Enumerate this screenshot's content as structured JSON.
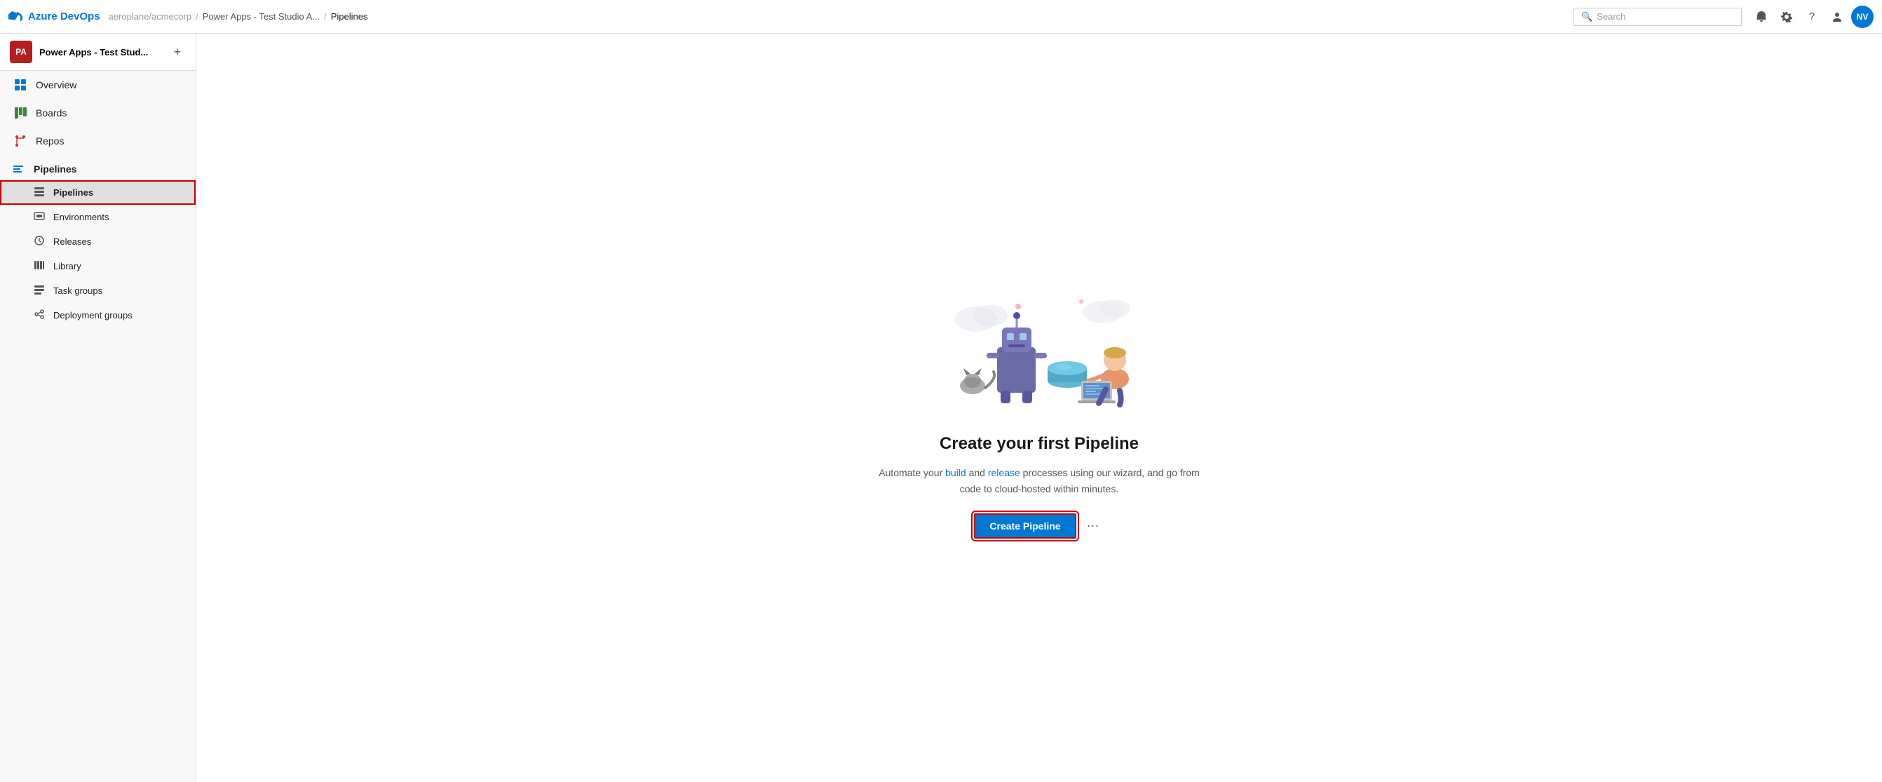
{
  "topNav": {
    "logoText": "Azure DevOps",
    "breadcrumb": {
      "org": "aeroplane/acmecorp",
      "sep1": "/",
      "project": "Power Apps - Test Studio A...",
      "sep2": "/",
      "current": "Pipelines"
    },
    "search": {
      "placeholder": "Search"
    },
    "avatarText": "NV"
  },
  "sidebar": {
    "projectAvatarText": "PA",
    "projectName": "Power Apps - Test Stud...",
    "addButtonLabel": "+",
    "navItems": [
      {
        "id": "overview",
        "label": "Overview",
        "icon": "overview"
      },
      {
        "id": "boards",
        "label": "Boards",
        "icon": "boards"
      },
      {
        "id": "repos",
        "label": "Repos",
        "icon": "repos"
      },
      {
        "id": "pipelines-section",
        "label": "Pipelines",
        "icon": "pipelines"
      }
    ],
    "subItems": [
      {
        "id": "pipelines",
        "label": "Pipelines",
        "icon": "pipelines-sub",
        "active": true
      },
      {
        "id": "environments",
        "label": "Environments",
        "icon": "environments"
      },
      {
        "id": "releases",
        "label": "Releases",
        "icon": "releases"
      },
      {
        "id": "library",
        "label": "Library",
        "icon": "library"
      },
      {
        "id": "task-groups",
        "label": "Task groups",
        "icon": "task-groups"
      },
      {
        "id": "deployment-groups",
        "label": "Deployment groups",
        "icon": "deployment-groups"
      }
    ]
  },
  "mainContent": {
    "title": "Create your first Pipeline",
    "description1": "Automate your build and ",
    "descriptionLink1": "build",
    "descriptionMiddle": " and release processes using our wizard, and go from",
    "descriptionLink2": "release",
    "description2": " processes using our wizard, and go from\ncode to cloud-hosted within minutes.",
    "createButtonLabel": "Create Pipeline",
    "moreOptionsLabel": "⋯"
  }
}
